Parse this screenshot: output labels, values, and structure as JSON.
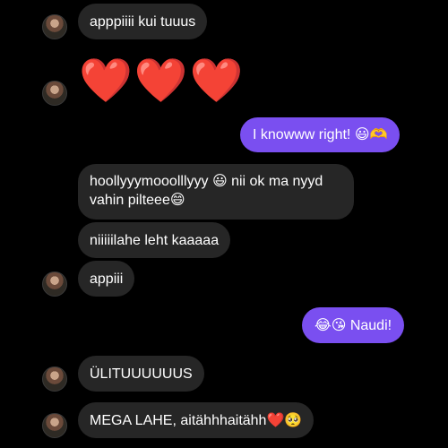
{
  "messages": [
    {
      "id": "m1",
      "side": "in",
      "text": "apppiiii kui tuuus"
    },
    {
      "id": "m2",
      "side": "in",
      "text": "❤️❤️❤️"
    },
    {
      "id": "m3",
      "side": "out",
      "text": "I knowww right! 😃🫶"
    },
    {
      "id": "m4",
      "side": "in",
      "line1": "hoollyyymooolllyyy 😃 nii ok ma nyyd",
      "line2": "vahin pilteee😄"
    },
    {
      "id": "m5",
      "side": "in",
      "text": "niiiiilahe leht kaaaaa"
    },
    {
      "id": "m6",
      "side": "in",
      "text": "appiii"
    },
    {
      "id": "m7",
      "side": "out",
      "text": "😂😘 Naudi!"
    },
    {
      "id": "m8",
      "side": "in",
      "text": "ÜLITUUUUUUS"
    },
    {
      "id": "m9",
      "side": "in",
      "text": "MEGA LAHE, aitähhhaitähh❤️🥺"
    }
  ],
  "colors": {
    "background": "#000000",
    "incoming_bubble": "#262626",
    "outgoing_bubble": "#7a4ff0",
    "text": "#ffffff"
  }
}
